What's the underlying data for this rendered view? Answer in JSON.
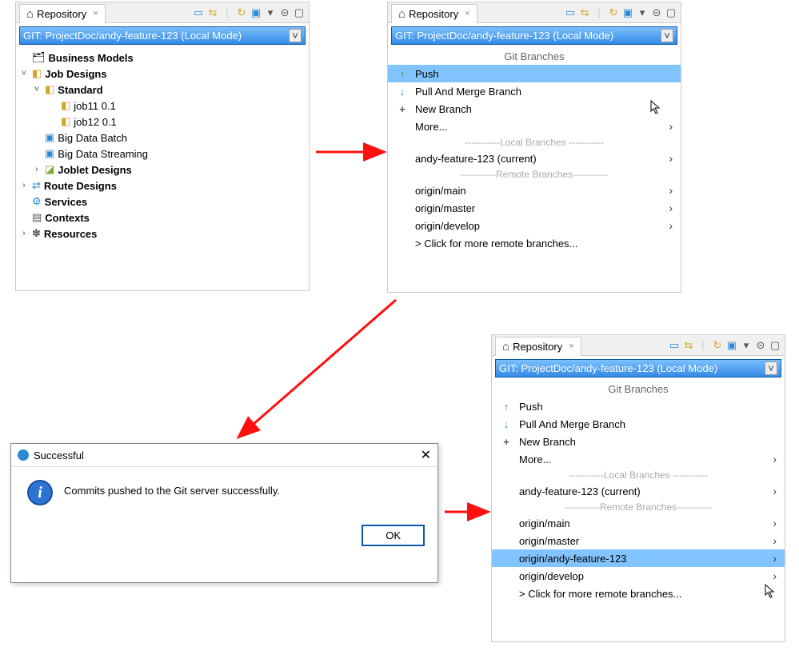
{
  "tab_label": "Repository",
  "repo_selector": "GIT: ProjectDoc/andy-feature-123   (Local Mode)",
  "toolbar_icons": [
    "≣",
    "⇆",
    "↻",
    "▣",
    "▾",
    "⊝",
    "□"
  ],
  "tree": {
    "business_models": "Business Models",
    "job_designs": "Job Designs",
    "standard": "Standard",
    "job11": "job11 0.1",
    "job12": "job12 0.1",
    "big_data_batch": "Big Data Batch",
    "big_data_streaming": "Big Data Streaming",
    "joblet_designs": "Joblet Designs",
    "route_designs": "Route Designs",
    "services": "Services",
    "contexts": "Contexts",
    "resources": "Resources"
  },
  "menu": {
    "header": "Git Branches",
    "push": "Push",
    "pull": "Pull And Merge Branch",
    "new_branch": "New Branch",
    "more": "More...",
    "sep_local": "-----------Local   Branches -----------",
    "sep_remote": "-----------Remote Branches-----------",
    "current_local": "andy-feature-123 (current)",
    "origin_main": "origin/main",
    "origin_master": "origin/master",
    "origin_develop": "origin/develop",
    "origin_andy": "origin/andy-feature-123",
    "more_remote": "> Click for more remote branches..."
  },
  "dialog": {
    "title": "Successful",
    "message": "Commits pushed to the Git server successfully.",
    "ok": "OK"
  }
}
